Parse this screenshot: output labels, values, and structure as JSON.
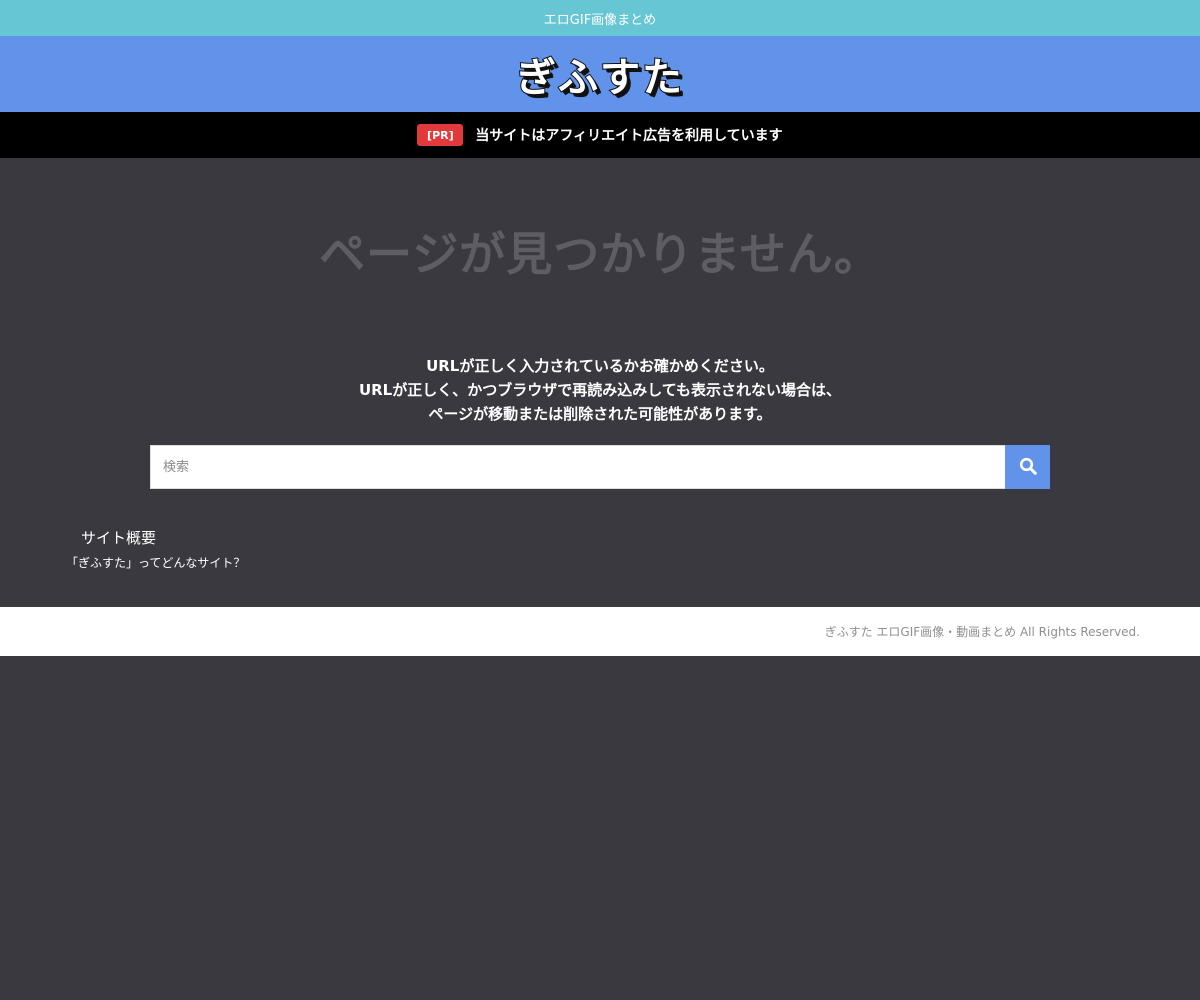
{
  "topbar": {
    "tagline": "エロGIF画像まとめ"
  },
  "header": {
    "logo_text": "ぎふすた"
  },
  "pr_bar": {
    "badge": "[PR]",
    "notice": "当サイトはアフィリエイト広告を利用しています"
  },
  "not_found": {
    "title": "ページが見つかりません。",
    "lines": [
      "URLが正しく入力されているかお確かめください。",
      "URLが正しく、かつブラウザで再読み込みしても表示されない場合は、",
      "ページが移動または削除された可能性があります。"
    ]
  },
  "search": {
    "placeholder": "検索",
    "value": "",
    "button_icon": "search-icon"
  },
  "widget": {
    "title": "サイト概要",
    "link_text": "「ぎふすた」ってどんなサイト？"
  },
  "footer": {
    "copyright": "ぎふすた エロGIF画像・動画まとめ All Rights Reserved."
  },
  "colors": {
    "topbar": "#67c6d4",
    "header": "#6193eb",
    "pr_badge": "#e23a3a",
    "background": "#3a393f",
    "search_button": "#6193eb"
  }
}
